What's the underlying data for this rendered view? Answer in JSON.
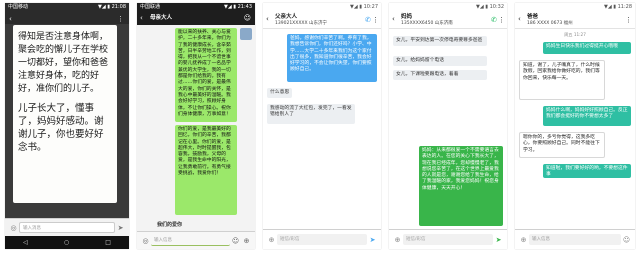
{
  "screens": [
    {
      "status_left": "中国移动 ",
      "status_right": "▼◢ ▮ 21:08",
      "handwritten_note": {
        "line1": "得知是否注意身体啊，聚会吃的懈儿子在学校一切都好，望你和爸爸注意好身体，吃的好好，准你们的儿子。",
        "line2": "儿子长大了，懂事了，妈妈好感动。谢谢儿子，你也要好好念书。"
      },
      "input_placeholder": "输入消息",
      "icons": [
        "back-icon",
        "menu-icon",
        "send-icon"
      ]
    },
    {
      "status_left": "中国联通",
      "status_right": "▼◢ ▮ 21:43",
      "contact": "母亲大人",
      "message": "能以来的扶养、关心与爱护，二十多年来，你们为了我的健康成长，含辛茹苦，日半辛劳地工作，到得，把我从一个不谙世事的婴儿抚养成了一名品学兼优的大学生，我的一切都是你们给我的。我有过……你们的爱，是最伟大的爱，你们的关怀，是我心中最美好的温暖。我会好好学习，照顾好身体，不让你们操心。祝你们身体健康，万事如意！",
      "message2": "你们的爱，是我最美好的回忆，你们的辛苦，我都记在心里。你们的爱，是超伟大，时时提醒我，包容我，鼓励我，父母的爱，是我生命中的阳光，让我勇敢前行。有勇气接受挑战，我爱你们！",
      "footer_title": "我们的爱你",
      "input_placeholder": "输入信息"
    },
    {
      "status_left": "",
      "status_right": "▼◢ ▮ 10:27",
      "contact": "父亲大人",
      "contact_sub": "139021XXXXX 山东济宁",
      "msg_out": "爸妈，感谢你们辛苦了啊。养育了我，我想告诉你们，你们还好吗？小学、中学……大学二十多年来我们为这个家付出了很多，我知道你们很辛苦，我会好好学习的，不会让你们失望，你们要照顾好自己。",
      "msg_in1": "什么意思",
      "msg_in2": "我感动的流了大红包，发完了，一看发错给别人了",
      "input_placeholder": "短信/彩信"
    },
    {
      "status_left": "",
      "status_right": "▼◢ ▮ 10:32",
      "contact": "妈妈",
      "contact_sub": "135XXXX6450 山东济南",
      "msg_in1": "女儿，平安到达第一次停电奇要尊多爸爸",
      "msg_in2": "女儿，给妈妈留个电话",
      "msg_in3": "女儿，下课啦要跟电话，着着",
      "msg_out": "妈妈：从来都很爱一个不需要语言去表达的人。在您的关心下我长大了，现在我已经成年，您却慢慢老了，我想说您辛苦了，在这个世界上最爱我的人就是您，谢谢您给了我生命，给了我温暖的家，我爱您妈妈！祝您身体健康，天天开心！",
      "input_placeholder": "短信/彩信"
    },
    {
      "status_left": "",
      "status_right": "▼◢ ▮ 11:28",
      "contact": "爸爸",
      "contact_sub": "186 XXXX 0673 福州",
      "time1": "周五 11:27",
      "msg_out1": "妈妈生日快乐我们过得挺开心哦哦",
      "msg_in1": "知道，谢了，儿子嘴真了，什么时候放假，回家我给你做好吃的，我们等你回来，快乐每一天。",
      "msg_out2": "妈妈什么啊，妈妈好好照顾自己。反正我们都会挺好的你不要想太多了",
      "msg_in2": "嗯你你的，多亏你觉得，这我多吃心，你要照顾好自己。同时不能往下学习。",
      "msg_out3": "知道啦，我们要好好的哟，不要想这件事",
      "input_placeholder": "输入信息"
    }
  ]
}
